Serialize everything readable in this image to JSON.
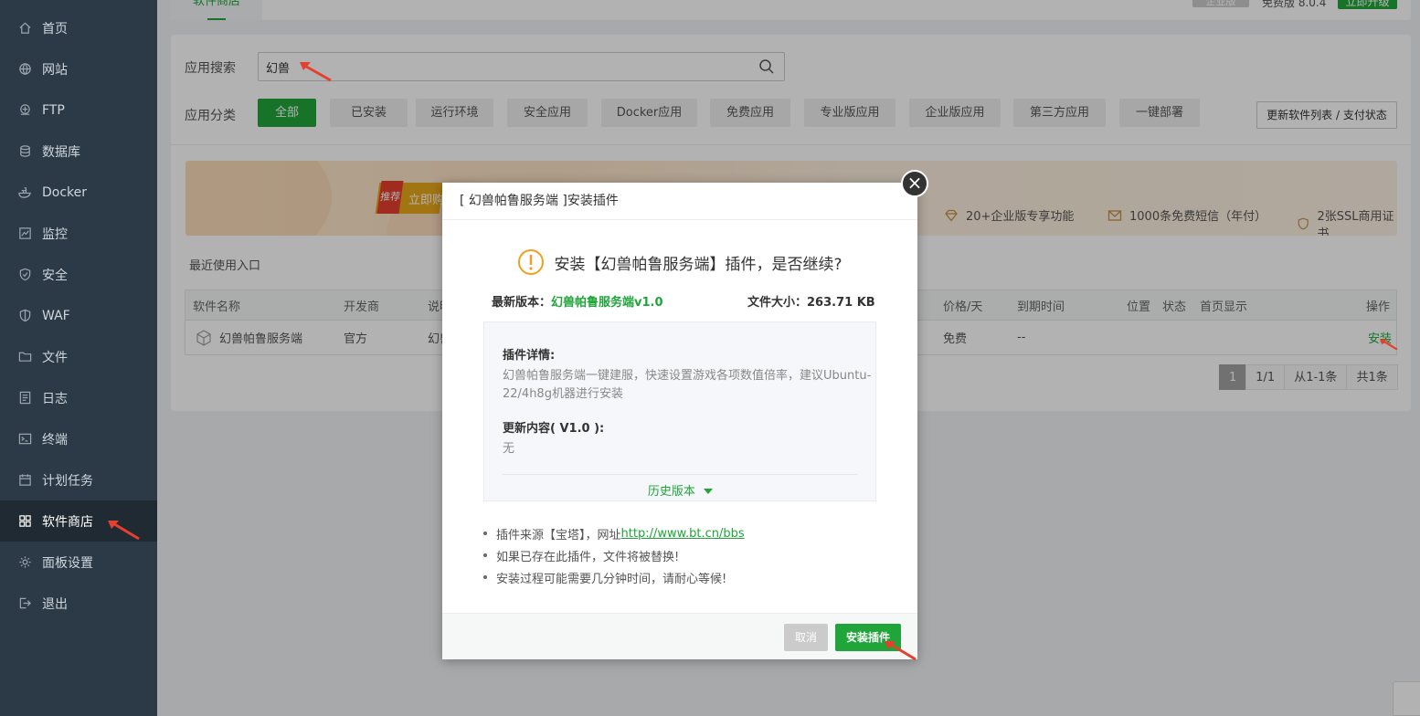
{
  "sidebar": {
    "items": [
      {
        "label": "首页",
        "icon": "home-icon"
      },
      {
        "label": "网站",
        "icon": "globe-icon"
      },
      {
        "label": "FTP",
        "icon": "ftp-icon"
      },
      {
        "label": "数据库",
        "icon": "database-icon"
      },
      {
        "label": "Docker",
        "icon": "docker-icon"
      },
      {
        "label": "监控",
        "icon": "monitor-icon"
      },
      {
        "label": "安全",
        "icon": "shield-icon"
      },
      {
        "label": "WAF",
        "icon": "waf-shield-icon"
      },
      {
        "label": "文件",
        "icon": "folder-icon"
      },
      {
        "label": "日志",
        "icon": "log-icon"
      },
      {
        "label": "终端",
        "icon": "terminal-icon"
      },
      {
        "label": "计划任务",
        "icon": "calendar-icon"
      },
      {
        "label": "软件商店",
        "icon": "apps-grid-icon",
        "active": true
      },
      {
        "label": "面板设置",
        "icon": "gear-icon"
      },
      {
        "label": "退出",
        "icon": "logout-icon"
      }
    ]
  },
  "topbar": {
    "tab": "软件商店",
    "edition_badge": "企业版",
    "free_text": "免费版  8.0.4",
    "upgrade": "立即升级"
  },
  "search": {
    "label": "应用搜索",
    "value": "幻兽"
  },
  "categories": {
    "label": "应用分类",
    "items": [
      "全部",
      "已安装",
      "运行环境",
      "安全应用",
      "Docker应用",
      "免费应用",
      "专业版应用",
      "企业版应用",
      "第三方应用",
      "一键部署"
    ],
    "active": "全部",
    "refresh": "更新软件列表 / 支付状态"
  },
  "banner": {
    "tag": "推荐",
    "cta": "立即购",
    "features": [
      "20+企业版专享功能",
      "1000条免费短信（年付）",
      "2张SSL商用证书"
    ]
  },
  "recent_label": "最近使用入口",
  "table": {
    "headers": {
      "name": "软件名称",
      "developer": "开发商",
      "desc": "说明",
      "price": "价格/天",
      "expire": "到期时间",
      "location": "位置",
      "status": "状态",
      "homepage": "首页显示",
      "action": "操作"
    },
    "row": {
      "name": "幻兽帕鲁服务端",
      "developer": "官方",
      "desc": "幻兽",
      "price": "免费",
      "expire": "--",
      "action": "安装"
    }
  },
  "pager": {
    "current": "1",
    "pages": "1/1",
    "range": "从1-1条",
    "total": "共1条"
  },
  "dialog": {
    "title": "[ 幻兽帕鲁服务端 ]安装插件",
    "question": "安装【幻兽帕鲁服务端】插件，是否继续?",
    "version_label": "最新版本：",
    "version_value": "幻兽帕鲁服务端v1.0",
    "size_label": "文件大小：",
    "size_value": "263.71 KB",
    "details_heading": "插件详情:",
    "details_line1": "幻兽帕鲁服务端一键建服，快速设置游戏各项数值倍率，建议Ubuntu-",
    "details_line2": "22/4h8g机器进行安装",
    "update_heading": "更新内容( V1.0 ):",
    "update_text": "无",
    "history": "历史版本",
    "tip1_prefix": "插件来源【宝塔】，网址 ",
    "tip1_link": "http://www.bt.cn/bbs",
    "tip2": "如果已存在此插件，文件将被替换!",
    "tip3": "安装过程可能需要几分钟时间，请耐心等候!",
    "cancel": "取消",
    "install": "安装插件",
    "close_symbol": "×"
  },
  "colors": {
    "accent": "#20a53a",
    "sidebar_bg": "#2c3a47",
    "annotation_arrow": "#e5402e"
  }
}
